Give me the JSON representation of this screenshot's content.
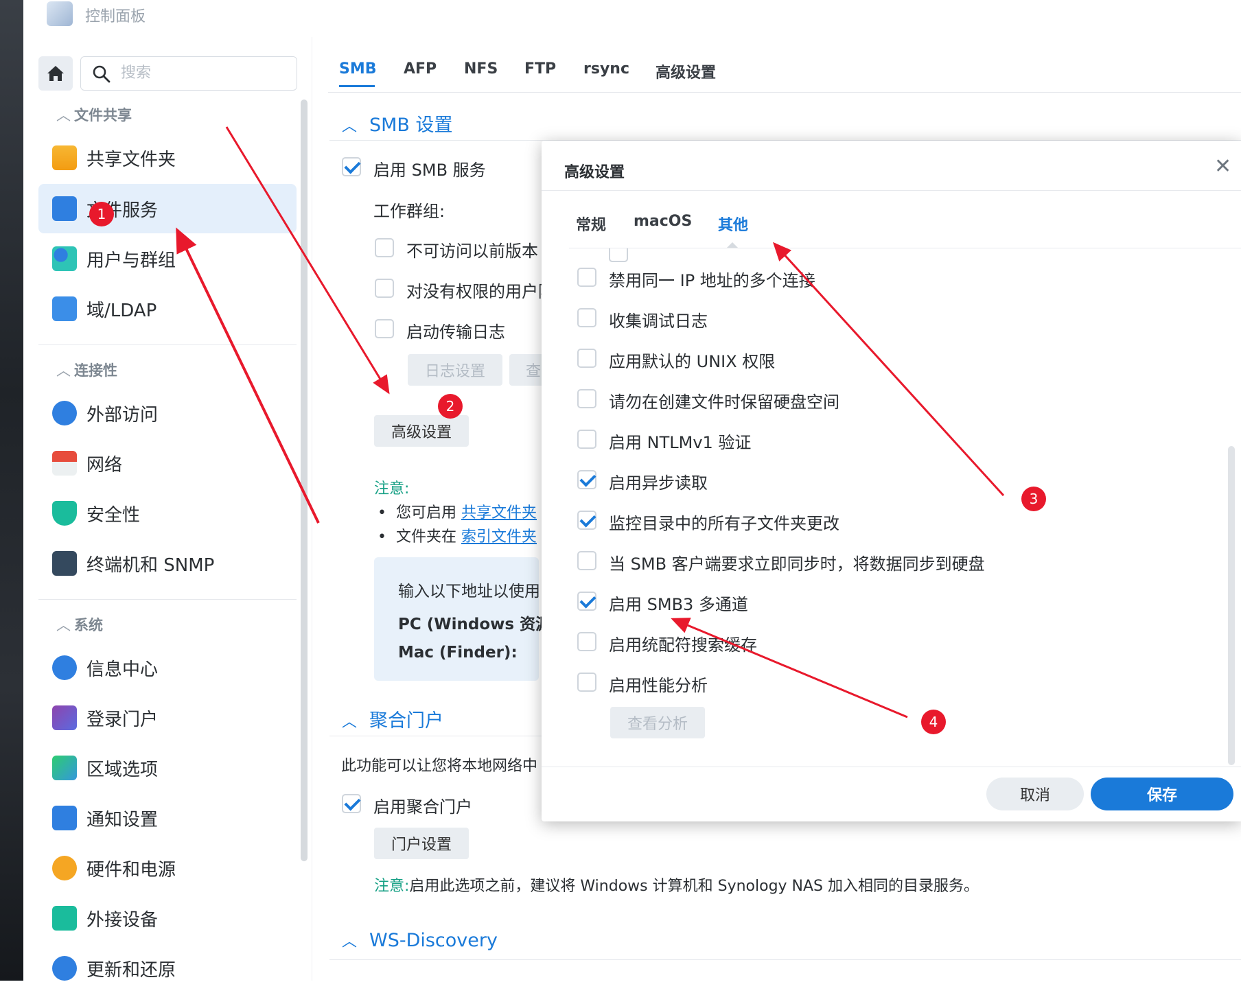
{
  "window": {
    "title": "控制面板"
  },
  "sidebar": {
    "search_placeholder": "搜索",
    "sections": [
      {
        "label": "文件共享",
        "items": [
          "共享文件夹",
          "文件服务",
          "用户与群组",
          "域/LDAP"
        ]
      },
      {
        "label": "连接性",
        "items": [
          "外部访问",
          "网络",
          "安全性",
          "终端机和 SNMP"
        ]
      },
      {
        "label": "系统",
        "items": [
          "信息中心",
          "登录门户",
          "区域选项",
          "通知设置",
          "硬件和电源",
          "外接设备",
          "更新和还原"
        ]
      }
    ],
    "active_item": "文件服务"
  },
  "main": {
    "tabs": [
      "SMB",
      "AFP",
      "NFS",
      "FTP",
      "rsync",
      "高级设置"
    ],
    "active_tab": "SMB",
    "smb_section": {
      "title": "SMB 设置",
      "enable_smb": {
        "label": "启用 SMB 服务",
        "checked": true
      },
      "workgroup_label": "工作群组:",
      "opt1": "不可访问以前版本",
      "opt2": "对没有权限的用户隐",
      "opt3": "启动传输日志",
      "log_settings_btn": "日志设置",
      "view_btn": "查",
      "advanced_btn": "高级设置",
      "note_label": "注意:",
      "bullet1_prefix": "您可启用",
      "bullet1_link": "共享文件夹",
      "bullet2_prefix": "文件夹在",
      "bullet2_link": "索引文件夹",
      "info_line1": "输入以下地址以使用",
      "info_pc": "PC (Windows 资源",
      "info_mac": "Mac (Finder):"
    },
    "portal_section": {
      "title": "聚合门户",
      "desc": "此功能可以让您将本地网络中",
      "enable": {
        "label": "启用聚合门户",
        "checked": true
      },
      "settings_btn": "门户设置",
      "note_label": "注意:",
      "note_text": "启用此选项之前，建议将 Windows 计算机和 Synology NAS 加入相同的目录服务。"
    },
    "ws_section": {
      "title": "WS-Discovery"
    }
  },
  "dialog": {
    "title": "高级设置",
    "tabs": [
      "常规",
      "macOS",
      "其他"
    ],
    "active_tab": "其他",
    "options": [
      {
        "label": "禁用同一 IP 地址的多个连接",
        "checked": false
      },
      {
        "label": "收集调试日志",
        "checked": false
      },
      {
        "label": "应用默认的 UNIX 权限",
        "checked": false
      },
      {
        "label": "请勿在创建文件时保留硬盘空间",
        "checked": false
      },
      {
        "label": "启用 NTLMv1 验证",
        "checked": false
      },
      {
        "label": "启用异步读取",
        "checked": true
      },
      {
        "label": "监控目录中的所有子文件夹更改",
        "checked": true
      },
      {
        "label": "当 SMB 客户端要求立即同步时，将数据同步到硬盘",
        "checked": false
      },
      {
        "label": "启用 SMB3 多通道",
        "checked": true
      },
      {
        "label": "启用统配符搜索缓存",
        "checked": false
      },
      {
        "label": "启用性能分析",
        "checked": false
      }
    ],
    "view_analysis_btn": "查看分析",
    "cancel": "取消",
    "save": "保存"
  },
  "annotations": [
    "1",
    "2",
    "3",
    "4"
  ],
  "colors": {
    "accent": "#1a7ad9",
    "annotation": "#e8192c",
    "note": "#16a085"
  }
}
